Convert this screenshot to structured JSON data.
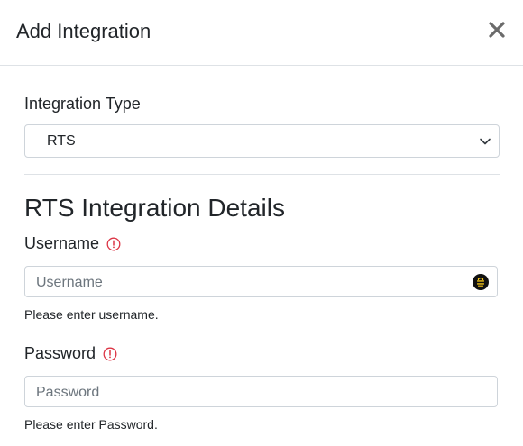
{
  "dialog": {
    "title": "Add Integration",
    "close_icon": "close-icon"
  },
  "integration_type": {
    "label": "Integration Type",
    "selected": "RTS"
  },
  "section": {
    "title": "RTS Integration Details"
  },
  "username": {
    "label": "Username",
    "placeholder": "Username",
    "value": "",
    "help": "Please enter username.",
    "status_icon": "alert-circle-icon",
    "autofill_icon": "password-manager-icon"
  },
  "password": {
    "label": "Password",
    "placeholder": "Password",
    "value": "",
    "help": "Please enter Password.",
    "status_icon": "alert-circle-icon"
  },
  "colors": {
    "text": "#212529",
    "border": "#ced4da",
    "error": "#dc3545",
    "placeholder": "#6c757d"
  }
}
